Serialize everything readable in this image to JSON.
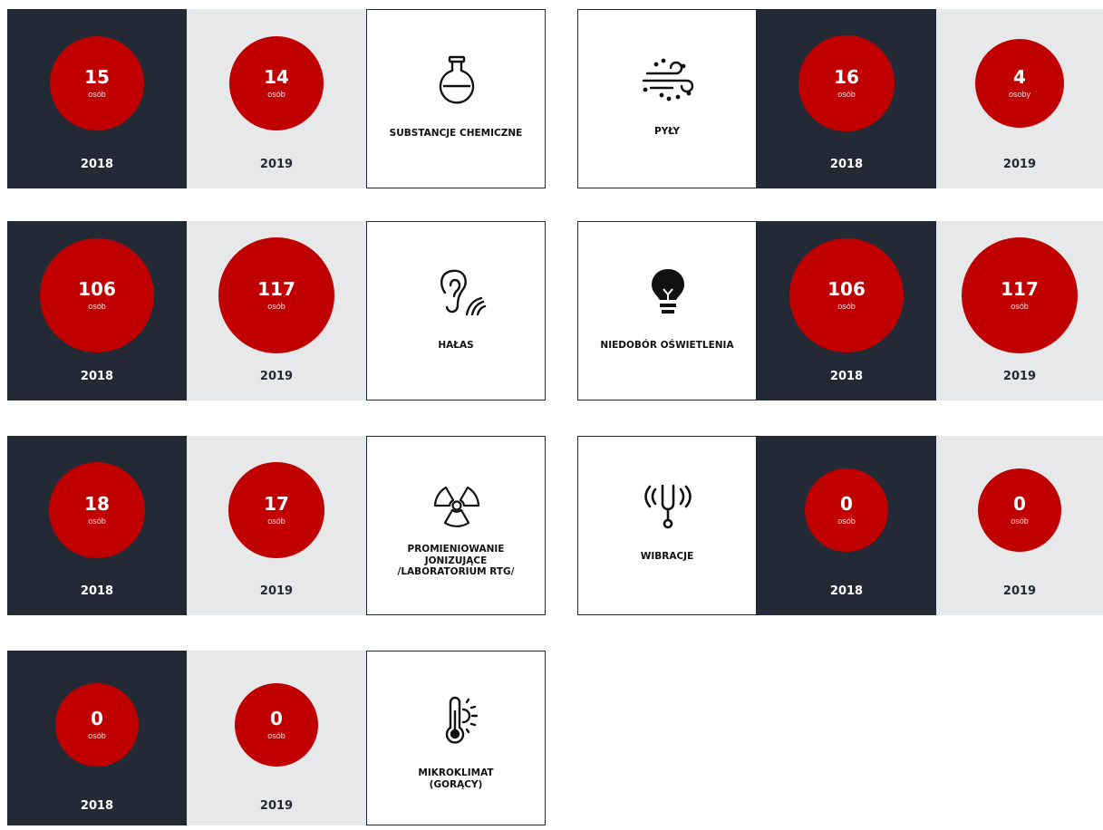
{
  "colors": {
    "dark": "#232a36",
    "light": "#e7e8ea",
    "accent": "#c00000"
  },
  "chart_data": {
    "type": "bubble-comparison",
    "years": [
      "2018",
      "2019"
    ],
    "categories": [
      {
        "label": "SUBSTANCJE CHEMICZNE",
        "icon": "flask-icon",
        "values": [
          15,
          14
        ],
        "units": [
          "osób",
          "osób"
        ]
      },
      {
        "label": "PYŁY",
        "icon": "wind-dust-icon",
        "values": [
          16,
          4
        ],
        "units": [
          "osób",
          "osoby"
        ]
      },
      {
        "label": "HAŁAS",
        "icon": "ear-noise-icon",
        "values": [
          106,
          117
        ],
        "units": [
          "osób",
          "osób"
        ]
      },
      {
        "label": "NIEDOBÓR OŚWIETLENIA",
        "icon": "lightbulb-icon",
        "values": [
          106,
          117
        ],
        "units": [
          "osób",
          "osób"
        ]
      },
      {
        "label": "PROMIENIOWANIE\nJONIZUJĄCE\n/LABORATORIUM RTG/",
        "icon": "radiation-icon",
        "values": [
          18,
          17
        ],
        "units": [
          "osób",
          "osób"
        ]
      },
      {
        "label": "WIBRACJE",
        "icon": "tuning-fork-icon",
        "values": [
          0,
          0
        ],
        "units": [
          "osób",
          "osób"
        ]
      },
      {
        "label": "MIKROKLIMAT\n(GORĄCY)",
        "icon": "thermometer-sun-icon",
        "values": [
          0,
          0
        ],
        "units": [
          "osób",
          "osób"
        ]
      }
    ]
  }
}
